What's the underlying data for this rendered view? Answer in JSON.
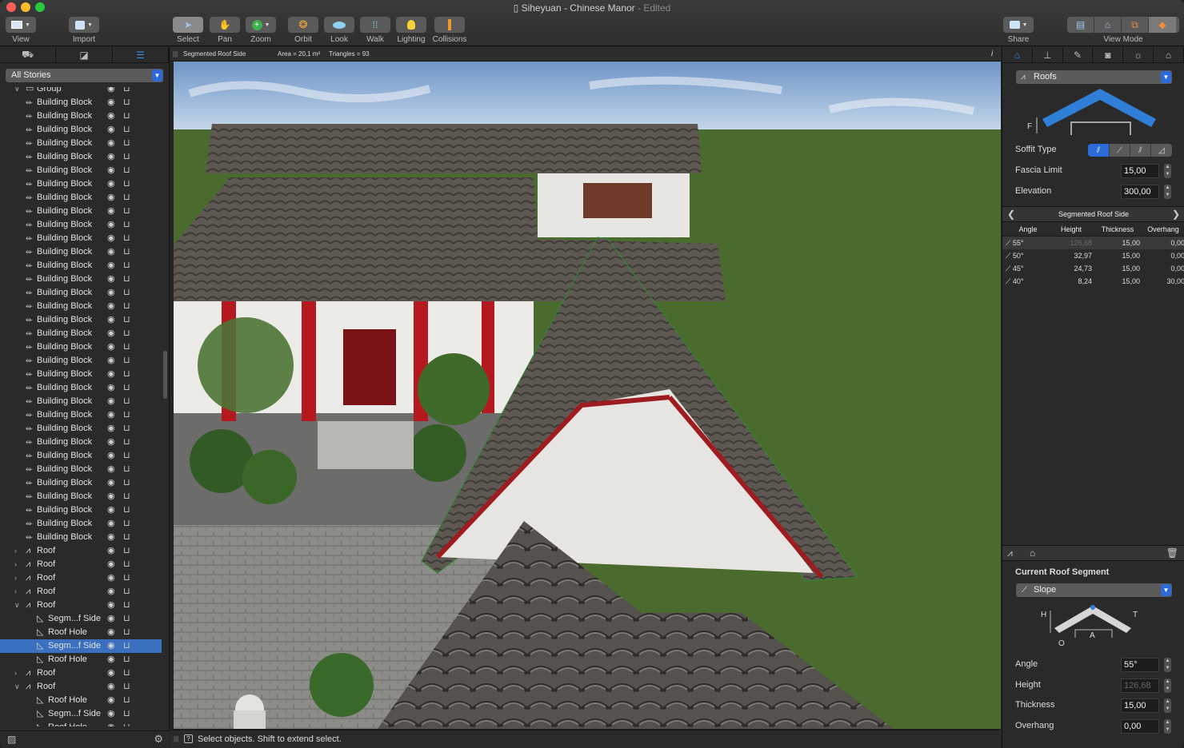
{
  "window": {
    "title": "Siheyuan - Chinese Manor",
    "title_suffix": "- Edited"
  },
  "toolbar": {
    "view": "View",
    "import": "Import",
    "select": "Select",
    "pan": "Pan",
    "zoom": "Zoom",
    "orbit": "Orbit",
    "look": "Look",
    "walk": "Walk",
    "lighting": "Lighting",
    "collisions": "Collisions",
    "share": "Share",
    "view_mode": "View Mode"
  },
  "left_panel": {
    "stories_select": "All Stories",
    "tree": [
      {
        "label": "Group",
        "level": 1,
        "icon": "folder-icon",
        "expand": "open",
        "selected": false
      },
      {
        "label": "Building Block",
        "level": 1,
        "icon": "building-block-icon",
        "expand": "",
        "selected": false
      },
      {
        "label": "Building Block",
        "level": 1,
        "icon": "building-block-icon",
        "expand": "",
        "selected": false
      },
      {
        "label": "Building Block",
        "level": 1,
        "icon": "building-block-icon",
        "expand": "",
        "selected": false
      },
      {
        "label": "Building Block",
        "level": 1,
        "icon": "building-block-icon",
        "expand": "",
        "selected": false
      },
      {
        "label": "Building Block",
        "level": 1,
        "icon": "building-block-icon",
        "expand": "",
        "selected": false
      },
      {
        "label": "Building Block",
        "level": 1,
        "icon": "building-block-icon",
        "expand": "",
        "selected": false
      },
      {
        "label": "Building Block",
        "level": 1,
        "icon": "building-block-icon",
        "expand": "",
        "selected": false
      },
      {
        "label": "Building Block",
        "level": 1,
        "icon": "building-block-icon",
        "expand": "",
        "selected": false
      },
      {
        "label": "Building Block",
        "level": 1,
        "icon": "building-block-icon",
        "expand": "",
        "selected": false
      },
      {
        "label": "Building Block",
        "level": 1,
        "icon": "building-block-icon",
        "expand": "",
        "selected": false
      },
      {
        "label": "Building Block",
        "level": 1,
        "icon": "building-block-icon",
        "expand": "",
        "selected": false
      },
      {
        "label": "Building Block",
        "level": 1,
        "icon": "building-block-icon",
        "expand": "",
        "selected": false
      },
      {
        "label": "Building Block",
        "level": 1,
        "icon": "building-block-icon",
        "expand": "",
        "selected": false
      },
      {
        "label": "Building Block",
        "level": 1,
        "icon": "building-block-icon",
        "expand": "",
        "selected": false
      },
      {
        "label": "Building Block",
        "level": 1,
        "icon": "building-block-icon",
        "expand": "",
        "selected": false
      },
      {
        "label": "Building Block",
        "level": 1,
        "icon": "building-block-icon",
        "expand": "",
        "selected": false
      },
      {
        "label": "Building Block",
        "level": 1,
        "icon": "building-block-icon",
        "expand": "",
        "selected": false
      },
      {
        "label": "Building Block",
        "level": 1,
        "icon": "building-block-icon",
        "expand": "",
        "selected": false
      },
      {
        "label": "Building Block",
        "level": 1,
        "icon": "building-block-icon",
        "expand": "",
        "selected": false
      },
      {
        "label": "Building Block",
        "level": 1,
        "icon": "building-block-icon",
        "expand": "",
        "selected": false
      },
      {
        "label": "Building Block",
        "level": 1,
        "icon": "building-block-icon",
        "expand": "",
        "selected": false
      },
      {
        "label": "Building Block",
        "level": 1,
        "icon": "building-block-icon",
        "expand": "",
        "selected": false
      },
      {
        "label": "Building Block",
        "level": 1,
        "icon": "building-block-icon",
        "expand": "",
        "selected": false
      },
      {
        "label": "Building Block",
        "level": 1,
        "icon": "building-block-icon",
        "expand": "",
        "selected": false
      },
      {
        "label": "Building Block",
        "level": 1,
        "icon": "building-block-icon",
        "expand": "",
        "selected": false
      },
      {
        "label": "Building Block",
        "level": 1,
        "icon": "building-block-icon",
        "expand": "",
        "selected": false
      },
      {
        "label": "Building Block",
        "level": 1,
        "icon": "building-block-icon",
        "expand": "",
        "selected": false
      },
      {
        "label": "Building Block",
        "level": 1,
        "icon": "building-block-icon",
        "expand": "",
        "selected": false
      },
      {
        "label": "Building Block",
        "level": 1,
        "icon": "building-block-icon",
        "expand": "",
        "selected": false
      },
      {
        "label": "Building Block",
        "level": 1,
        "icon": "building-block-icon",
        "expand": "",
        "selected": false
      },
      {
        "label": "Building Block",
        "level": 1,
        "icon": "building-block-icon",
        "expand": "",
        "selected": false
      },
      {
        "label": "Building Block",
        "level": 1,
        "icon": "building-block-icon",
        "expand": "",
        "selected": false
      },
      {
        "label": "Building Block",
        "level": 1,
        "icon": "building-block-icon",
        "expand": "",
        "selected": false
      },
      {
        "label": "Roof",
        "level": 1,
        "icon": "roof-icon",
        "expand": "closed",
        "selected": false
      },
      {
        "label": "Roof",
        "level": 1,
        "icon": "roof-icon",
        "expand": "closed",
        "selected": false
      },
      {
        "label": "Roof",
        "level": 1,
        "icon": "roof-icon",
        "expand": "closed",
        "selected": false
      },
      {
        "label": "Roof",
        "level": 1,
        "icon": "roof-icon",
        "expand": "closed",
        "selected": false
      },
      {
        "label": "Roof",
        "level": 1,
        "icon": "roof-icon",
        "expand": "open",
        "selected": false
      },
      {
        "label": "Segm...f Side",
        "level": 2,
        "icon": "roof-side-icon",
        "expand": "",
        "selected": false
      },
      {
        "label": "Roof Hole",
        "level": 2,
        "icon": "roof-hole-icon",
        "expand": "",
        "selected": false
      },
      {
        "label": "Segm...f Side",
        "level": 2,
        "icon": "roof-side-icon",
        "expand": "",
        "selected": true
      },
      {
        "label": "Roof Hole",
        "level": 2,
        "icon": "roof-hole-icon",
        "expand": "",
        "selected": false
      },
      {
        "label": "Roof",
        "level": 1,
        "icon": "roof-icon",
        "expand": "closed",
        "selected": false
      },
      {
        "label": "Roof",
        "level": 1,
        "icon": "roof-icon",
        "expand": "open",
        "selected": false
      },
      {
        "label": "Roof Hole",
        "level": 2,
        "icon": "roof-hole-icon",
        "expand": "",
        "selected": false
      },
      {
        "label": "Segm...f Side",
        "level": 2,
        "icon": "roof-side-icon",
        "expand": "",
        "selected": false
      },
      {
        "label": "Roof Hole",
        "level": 2,
        "icon": "roof-hole-icon",
        "expand": "",
        "selected": false
      }
    ]
  },
  "info_bar": {
    "object": "Segmented Roof Side",
    "area": "Area = 20,1 m²",
    "triangles": "Triangles = 93"
  },
  "status_bar": {
    "hint": "Select objects. Shift to extend select."
  },
  "inspector": {
    "category": "Roofs",
    "soffit_type_label": "Soffit Type",
    "fascia_limit_label": "Fascia Limit",
    "fascia_limit_value": "15,00",
    "elevation_label": "Elevation",
    "elevation_value": "300,00",
    "diagram_label_f": "F",
    "segment_nav_title": "Segmented Roof Side",
    "table_headers": [
      "Angle",
      "Height",
      "Thickness",
      "Overhang"
    ],
    "table_rows": [
      {
        "angle": "55°",
        "height": "126,68",
        "thickness": "15,00",
        "overhang": "0,00"
      },
      {
        "angle": "50°",
        "height": "32,97",
        "thickness": "15,00",
        "overhang": "0,00"
      },
      {
        "angle": "45°",
        "height": "24,73",
        "thickness": "15,00",
        "overhang": "0,00"
      },
      {
        "angle": "40°",
        "height": "8,24",
        "thickness": "15,00",
        "overhang": "30,00"
      }
    ],
    "current_segment_title": "Current Roof Segment",
    "segment_type": "Slope",
    "seg_diagram_labels": {
      "h": "H",
      "t": "T",
      "a": "A",
      "o": "O"
    },
    "angle_label": "Angle",
    "angle_value": "55°",
    "height_label": "Height",
    "height_value": "126,68",
    "thickness_label": "Thickness",
    "thickness_value": "15,00",
    "overhang_label": "Overhang",
    "overhang_value": "0,00"
  },
  "colors": {
    "accent": "#2b6ad8",
    "selection": "#3b6fc0",
    "roof_diagram": "#2f7fd6"
  }
}
